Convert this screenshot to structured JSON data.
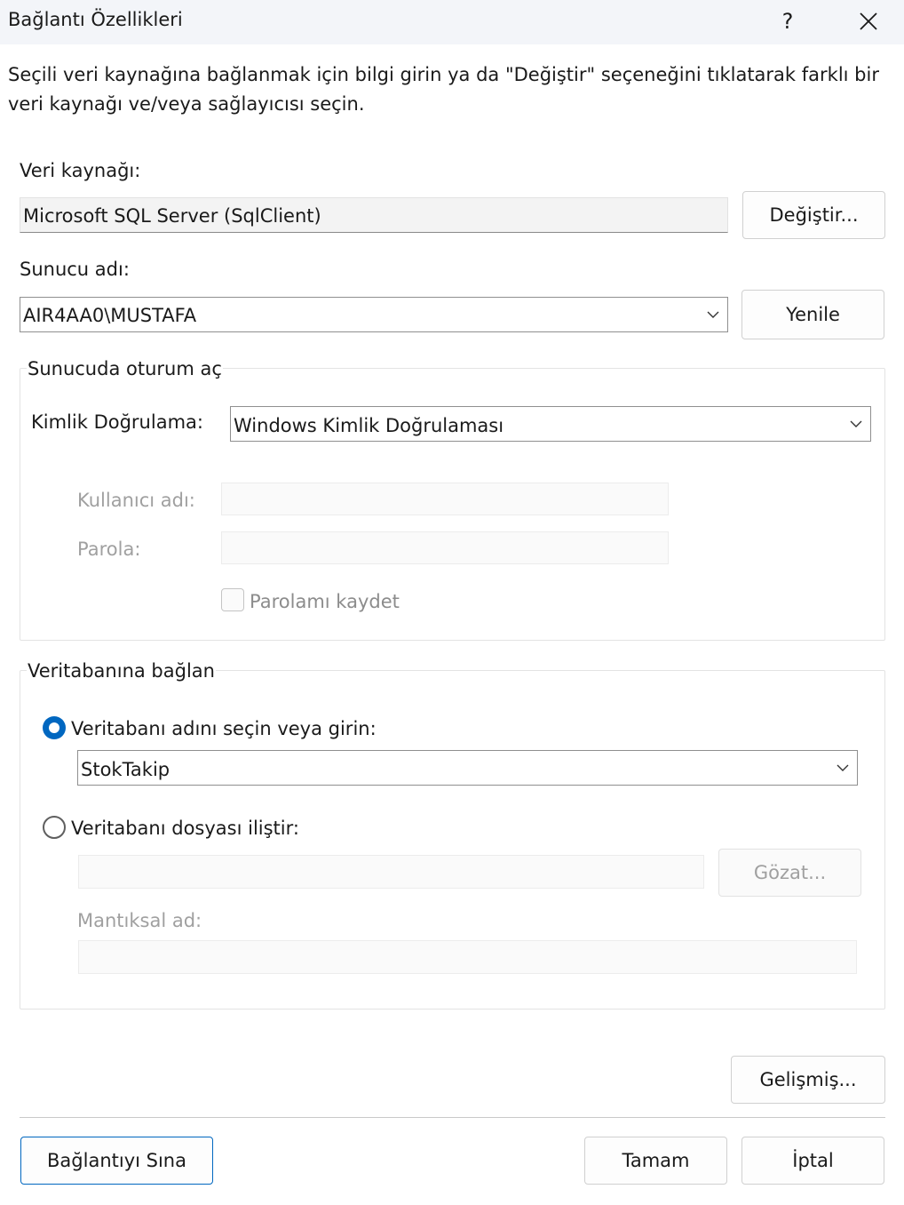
{
  "window": {
    "title": "Bağlantı Özellikleri",
    "help_label": "?"
  },
  "intro_text": "Seçili veri kaynağına bağlanmak için bilgi girin ya da \"Değiştir\" seçeneğini tıklatarak farklı bir veri kaynağı ve/veya sağlayıcısı seçin.",
  "data_source": {
    "label": "Veri kaynağı:",
    "value": "Microsoft SQL Server (SqlClient)",
    "change_button": "Değiştir..."
  },
  "server": {
    "label": "Sunucu adı:",
    "value": "AIR4AA0\\MUSTAFA",
    "refresh_button": "Yenile"
  },
  "logon_group": {
    "title": "Sunucuda oturum aç",
    "auth_label": "Kimlik Doğrulama:",
    "auth_value": "Windows Kimlik Doğrulaması",
    "username_label": "Kullanıcı adı:",
    "username_value": "",
    "password_label": "Parola:",
    "password_value": "",
    "save_password_label": "Parolamı kaydet",
    "save_password_checked": false
  },
  "database_group": {
    "title": "Veritabanına bağlan",
    "select_option_label": "Veritabanı adını seçin veya girin:",
    "select_option_selected": true,
    "database_value": "StokTakip",
    "attach_option_label": "Veritabanı dosyası iliştir:",
    "attach_option_selected": false,
    "attach_file_value": "",
    "browse_button": "Gözat...",
    "logical_name_label": "Mantıksal ad:",
    "logical_name_value": ""
  },
  "advanced_button": "Gelişmiş...",
  "footer": {
    "test_button": "Bağlantıyı Sına",
    "ok_button": "Tamam",
    "cancel_button": "İptal"
  },
  "colors": {
    "accent": "#0067c0",
    "disabled_text": "#a0a0a0",
    "titlebar": "#f3f5f9"
  }
}
